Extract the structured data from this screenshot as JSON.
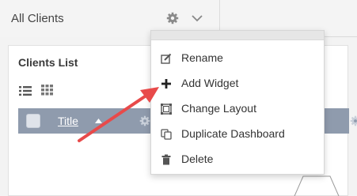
{
  "header": {
    "dashboard_title": "All Clients",
    "icons": [
      "gear-icon",
      "chevron-down-icon"
    ]
  },
  "widget": {
    "title": "Clients List",
    "view_icons": [
      "list-view-icon",
      "grid-view-icon"
    ],
    "table": {
      "columns": [
        "Title"
      ],
      "sort": "ascending"
    }
  },
  "menu": {
    "items": [
      {
        "label": "Rename",
        "icon": "edit-icon"
      },
      {
        "label": "Add Widget",
        "icon": "plus-icon"
      },
      {
        "label": "Change Layout",
        "icon": "layout-icon"
      },
      {
        "label": "Duplicate Dashboard",
        "icon": "duplicate-icon"
      },
      {
        "label": "Delete",
        "icon": "trash-icon"
      }
    ]
  },
  "colors": {
    "table_header": "#8f9bad",
    "annotation_arrow": "#e84a4a"
  }
}
